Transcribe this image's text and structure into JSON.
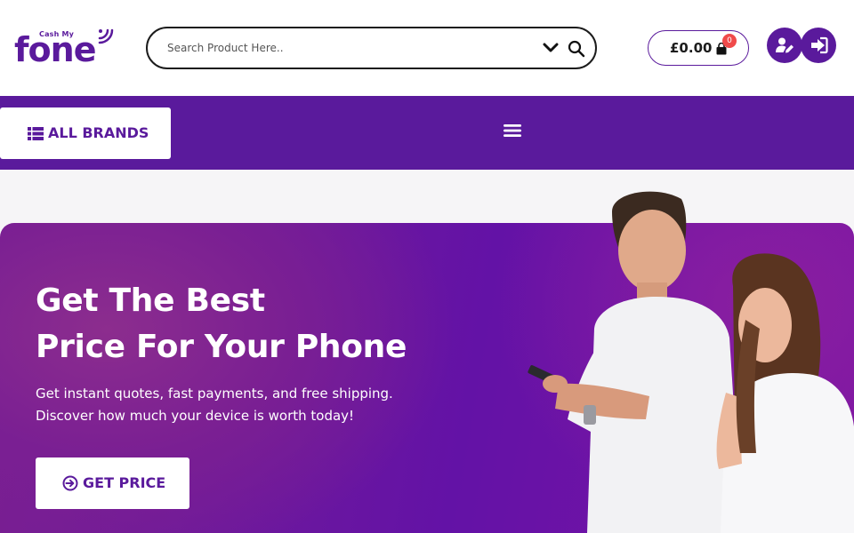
{
  "brand": {
    "logo_small": "Cash My",
    "logo_big": "fone",
    "primary_color": "#5a1a9c",
    "accent_color": "#f04a4a"
  },
  "header": {
    "search": {
      "placeholder": "Search Product Here..",
      "value": "",
      "dropdown_icon": "chevron-down-icon",
      "search_icon": "search-icon"
    },
    "cart": {
      "total": "£0.00",
      "count": "0",
      "icon": "shopping-bag-icon"
    },
    "user_actions": [
      {
        "name": "register",
        "icon": "user-edit-icon"
      },
      {
        "name": "login",
        "icon": "sign-in-icon"
      }
    ]
  },
  "nav": {
    "all_brands_label": "ALL BRANDS",
    "all_brands_icon": "list-icon",
    "menu_icon": "hamburger-icon"
  },
  "hero": {
    "title_line1": "Get The Best",
    "title_line2": "Price For Your Phone",
    "subtitle_line1": "Get instant quotes, fast payments, and free shipping.",
    "subtitle_line2": "Discover how much your device is worth today!",
    "cta_label": "GET PRICE",
    "cta_icon": "arrow-circle-right-icon",
    "image": "couple-with-phone-photo"
  }
}
